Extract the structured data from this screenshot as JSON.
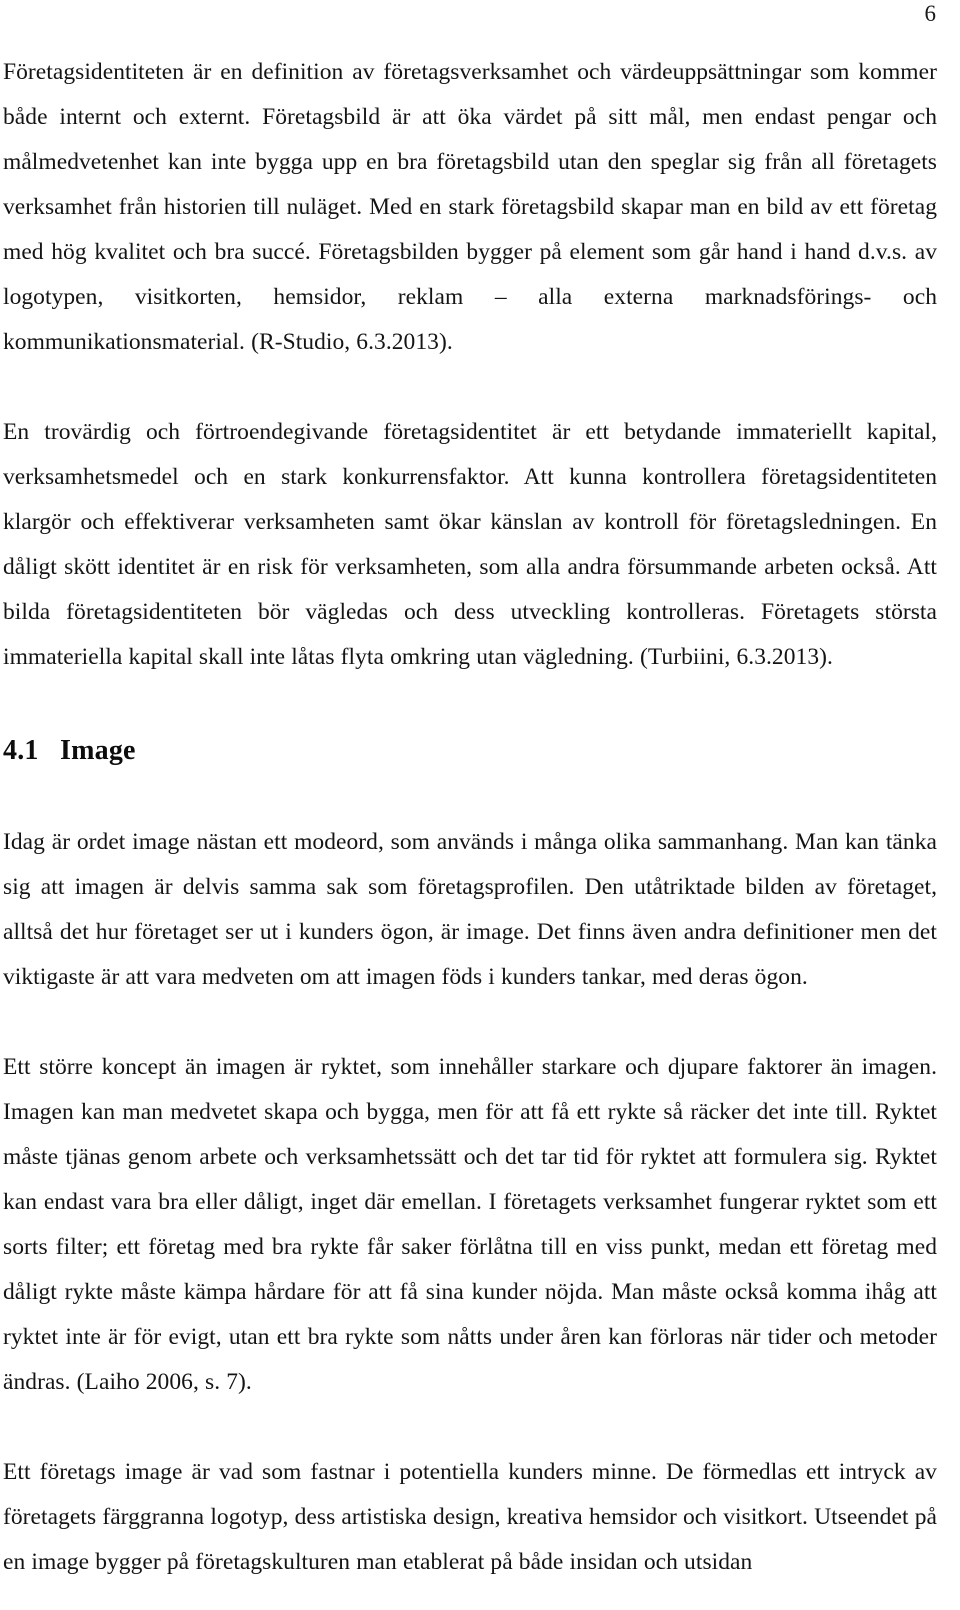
{
  "page": {
    "number": "6",
    "background_color": "#ffffff",
    "text_color": "#141414"
  },
  "content": {
    "paragraph_1": "Företagsidentiteten är en definition av företagsverksamhet och värdeuppsättningar som kommer både internt och externt. Företagsbild är att öka värdet på sitt mål, men endast pengar och målmedvetenhet kan inte bygga upp en bra företagsbild utan den speglar sig från all företagets verksamhet från historien till nuläget. Med en stark företagsbild skapar man en bild av ett företag med hög kvalitet och bra succé. Företagsbilden bygger på element som går hand i hand d.v.s. av logotypen, visitkorten, hemsidor, reklam – alla externa marknadsförings- och kommunikationsmaterial. (R-Studio, 6.3.2013).",
    "paragraph_2": "En trovärdig och förtroendegivande företagsidentitet är ett betydande immateriellt kapital, verksamhetsmedel och en stark konkurrensfaktor. Att kunna kontrollera företagsidentiteten klargör och effektiverar verksamheten samt ökar känslan av kontroll för företagsledningen. En dåligt skött identitet är en risk för verksamheten, som alla andra försummande arbeten också. Att bilda företagsidentiteten bör vägledas och dess utveckling kontrolleras. Företagets största immateriella kapital skall inte låtas flyta omkring utan vägledning. (Turbiini, 6.3.2013).",
    "heading_number": "4.1",
    "heading_title": "Image",
    "paragraph_3": "Idag är ordet image nästan ett modeord, som används i många olika sammanhang. Man kan tänka sig att imagen är delvis samma sak som företagsprofilen. Den utåtriktade bilden av företaget, alltså det hur företaget ser ut i kunders ögon, är image. Det finns även andra definitioner men det viktigaste är att vara medveten om att imagen föds i kunders tankar, med deras ögon.",
    "paragraph_4": "Ett större koncept än imagen är ryktet, som innehåller starkare och djupare faktorer än imagen. Imagen kan man medvetet skapa och bygga, men för att få ett rykte så räcker det inte till. Ryktet måste tjänas genom arbete och verksamhetssätt och det tar tid för ryktet att formulera sig. Ryktet kan endast vara bra eller dåligt, inget där emellan. I företagets verksamhet fungerar ryktet som ett sorts filter; ett företag med bra rykte får saker förlåtna till en viss punkt, medan ett företag med dåligt rykte måste kämpa hårdare för att få sina kunder nöjda. Man måste också komma ihåg att ryktet inte är för evigt, utan ett bra rykte som nåtts under åren kan förloras när tider och metoder ändras. (Laiho 2006, s. 7).",
    "paragraph_5": "Ett företags image är vad som fastnar i potentiella kunders minne. De förmedlas ett intryck av företagets färggranna logotyp, dess artistiska design, kreativa hemsidor och visitkort. Utseendet på en image bygger på företagskulturen man etablerat på både insidan och utsidan"
  }
}
